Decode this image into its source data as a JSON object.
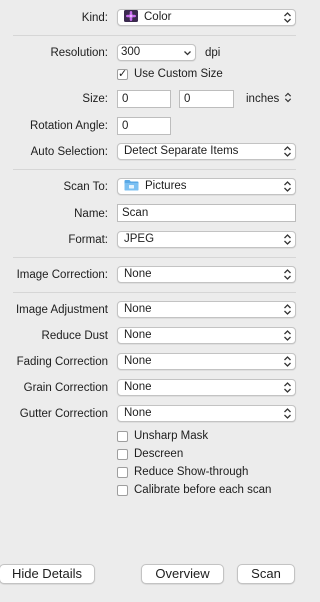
{
  "kind": {
    "label": "Kind:",
    "value": "Color",
    "icon": "color-photo-icon"
  },
  "resolution": {
    "label": "Resolution:",
    "value": "300",
    "unit": "dpi"
  },
  "custom_size": {
    "label": "Use Custom Size",
    "checked": true
  },
  "size": {
    "label": "Size:",
    "width": "0",
    "height": "0",
    "unit": "inches"
  },
  "rotation": {
    "label": "Rotation Angle:",
    "value": "0"
  },
  "auto_selection": {
    "label": "Auto Selection:",
    "value": "Detect Separate Items"
  },
  "scan_to": {
    "label": "Scan To:",
    "value": "Pictures",
    "icon": "folder-icon"
  },
  "name": {
    "label": "Name:",
    "value": "Scan"
  },
  "format": {
    "label": "Format:",
    "value": "JPEG"
  },
  "image_correction": {
    "label": "Image Correction:",
    "value": "None"
  },
  "image_adjustment": {
    "label": "Image Adjustment",
    "value": "None"
  },
  "reduce_dust": {
    "label": "Reduce Dust",
    "value": "None"
  },
  "fading_correction": {
    "label": "Fading Correction",
    "value": "None"
  },
  "grain_correction": {
    "label": "Grain Correction",
    "value": "None"
  },
  "gutter_correction": {
    "label": "Gutter Correction",
    "value": "None"
  },
  "checkboxes": [
    {
      "label": "Unsharp Mask",
      "checked": false
    },
    {
      "label": "Descreen",
      "checked": false
    },
    {
      "label": "Reduce Show-through",
      "checked": false
    },
    {
      "label": "Calibrate before each scan",
      "checked": false
    }
  ],
  "buttons": {
    "hide_details": "Hide Details",
    "overview": "Overview",
    "scan": "Scan"
  },
  "colors": {
    "background": "#ececec",
    "folder": "#5aa9e6",
    "flower": "#a14fd1"
  }
}
